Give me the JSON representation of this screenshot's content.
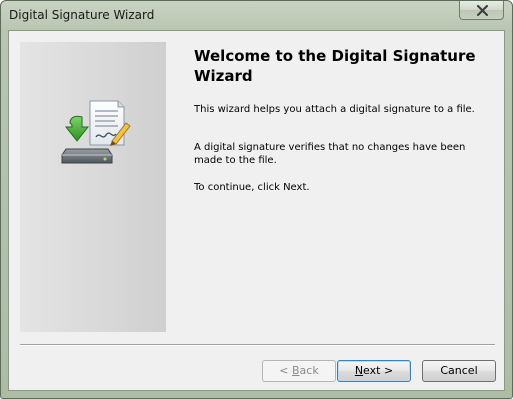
{
  "window": {
    "title": "Digital Signature Wizard"
  },
  "content": {
    "heading": "Welcome to the Digital Signature Wizard",
    "paragraphs": [
      "This wizard helps you attach a digital signature to a file.",
      "A digital signature verifies that no changes have been made to the file.",
      "To continue, click Next."
    ]
  },
  "buttons": {
    "back": {
      "prefix": "< ",
      "mnemonic": "B",
      "rest": "ack",
      "enabled": false
    },
    "next": {
      "mnemonic": "N",
      "rest": "ext >",
      "default": true
    },
    "cancel": "Cancel"
  },
  "icons": {
    "close": "close-icon",
    "wizard": "digital-signature-icon"
  },
  "colors": {
    "frame": "#b9c5b1",
    "client_bg": "#f0f0f0",
    "default_button_border": "#3c7fb1",
    "icon_arrow": "#3fa536"
  }
}
